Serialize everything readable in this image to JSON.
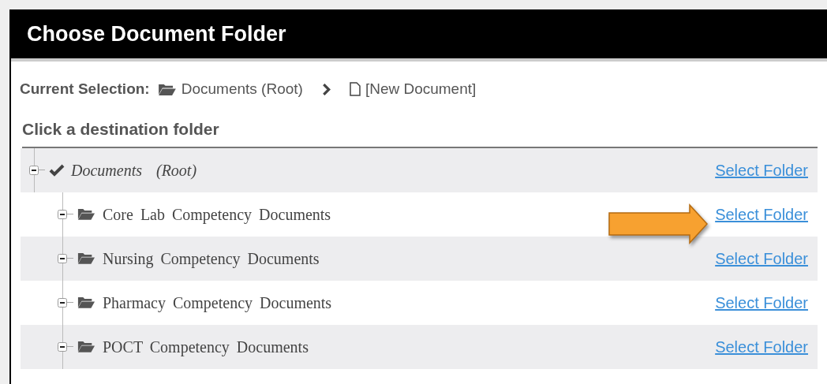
{
  "window": {
    "title": "Choose Document Folder"
  },
  "current_selection": {
    "label": "Current Selection:",
    "path": [
      {
        "kind": "folder",
        "text": "Documents (Root)"
      },
      {
        "kind": "document",
        "text": "[New Document]"
      }
    ]
  },
  "tree": {
    "heading": "Click a destination folder",
    "nodes": [
      {
        "name": "Documents  (Root)",
        "selected": true,
        "expanded": true,
        "action": "Select Folder",
        "children": [
          {
            "name": "Core Lab Competency Documents",
            "selected": false,
            "expanded": true,
            "action": "Select Folder"
          },
          {
            "name": "Nursing Competency Documents",
            "selected": false,
            "expanded": true,
            "action": "Select Folder"
          },
          {
            "name": "Pharmacy Competency Documents",
            "selected": false,
            "expanded": true,
            "action": "Select Folder"
          },
          {
            "name": "POCT Competency Documents",
            "selected": false,
            "expanded": true,
            "action": "Select Folder"
          }
        ]
      }
    ]
  }
}
